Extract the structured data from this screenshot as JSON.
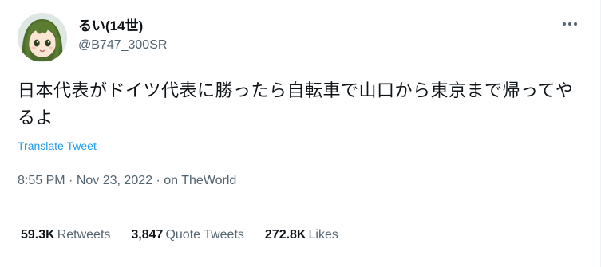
{
  "user": {
    "display_name": "るい(14世)",
    "handle": "@B747_300SR",
    "avatar_icon": "anime-avatar-icon"
  },
  "more_icon": "more-horizontal-icon",
  "tweet": {
    "text": "日本代表がドイツ代表に勝ったら自転車で山口から東京まで帰ってやるよ",
    "translate_label": "Translate Tweet",
    "time": "8:55 PM",
    "date": "Nov 23, 2022",
    "separator": "·",
    "source_prefix": "on",
    "source": "TheWorld"
  },
  "stats": {
    "retweets_count": "59.3K",
    "retweets_label": "Retweets",
    "quotes_count": "3,847",
    "quotes_label": "Quote Tweets",
    "likes_count": "272.8K",
    "likes_label": "Likes"
  },
  "colors": {
    "text": "#0f1419",
    "secondary": "#536471",
    "link": "#1d9bf0",
    "divider": "#eff3f4"
  }
}
